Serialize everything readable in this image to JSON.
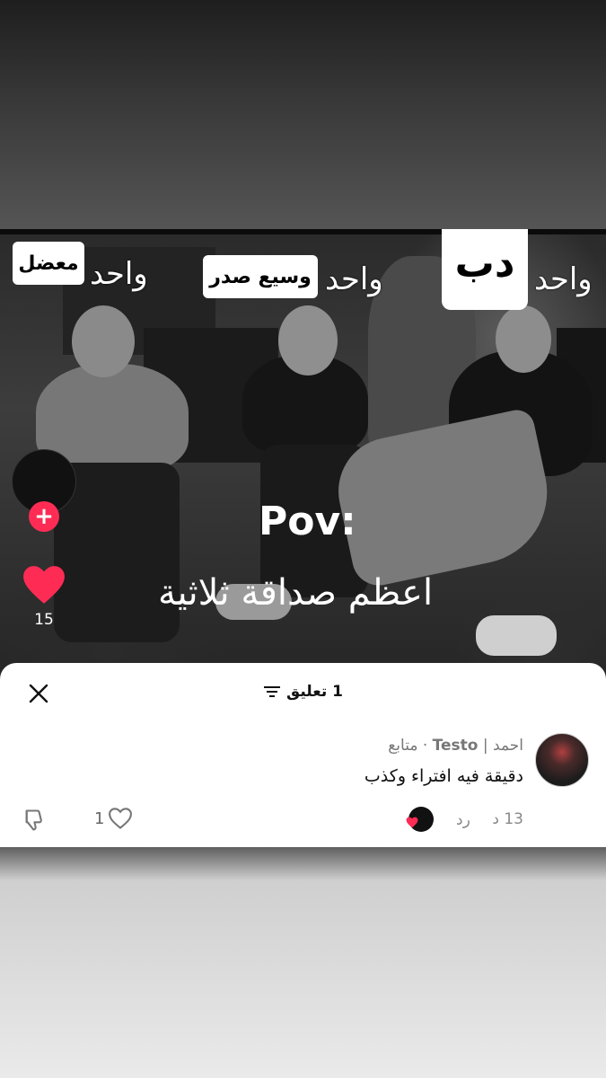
{
  "overlay": {
    "wahid_1": "واحد",
    "tag_1": "معضل",
    "wahid_2": "واحد",
    "tag_2": "وسيع صدر",
    "wahid_3": "واحد",
    "tag_3": "دب",
    "pov_title": "Pov:",
    "pov_caption": "اعظم صداقة ثلاثية"
  },
  "side_actions": {
    "like_count": "15"
  },
  "comments_sheet": {
    "header_count": "1 تعليق",
    "comment": {
      "author_name": "احمد",
      "author_handle": "Testo",
      "follow_label": "متابع",
      "text": "دقيقة فيه افتراء وكذب",
      "time": "13 د",
      "reply_label": "رد",
      "like_count": "1"
    }
  },
  "colors": {
    "accent_red": "#fe2c55",
    "sheet_bg": "#ffffff"
  },
  "icons": [
    "close-icon",
    "filter-icon",
    "thumbs-down-icon",
    "heart-outline-icon",
    "heart-filled-icon",
    "plus-icon"
  ]
}
